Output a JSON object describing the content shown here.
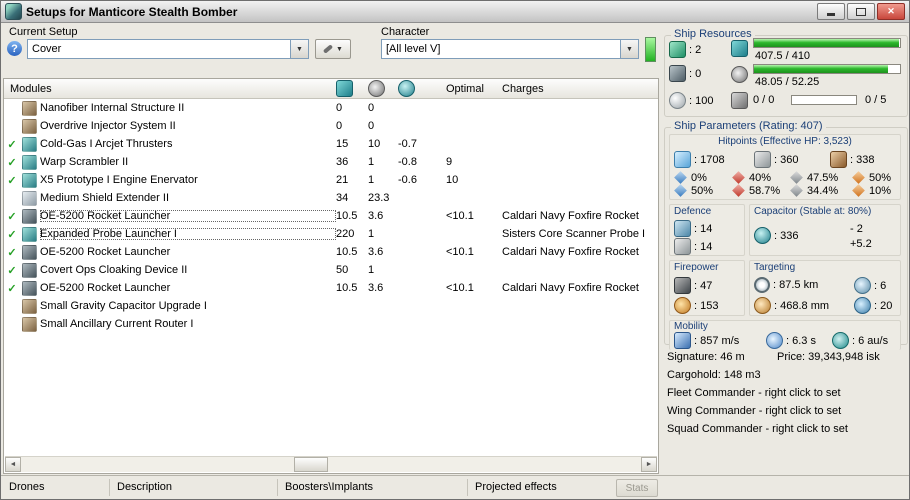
{
  "window": {
    "title": "Setups for Manticore Stealth Bomber"
  },
  "icons": {
    "help": "?",
    "arrow_down": "▼",
    "close": "✕",
    "scroll_left": "◄",
    "scroll_right": "►"
  },
  "toolbar": {
    "current_setup_label": "Current Setup",
    "current_setup_value": "Cover",
    "character_label": "Character",
    "character_value": "[All level V]"
  },
  "modules": {
    "header": {
      "title": "Modules",
      "optimal": "Optimal",
      "charges": "Charges"
    },
    "rows": [
      {
        "check": "",
        "name": "Nanofiber Internal Structure II",
        "cpu": "0",
        "pg": "0",
        "cap": "",
        "optimal": "",
        "charges": ""
      },
      {
        "check": "",
        "name": "Overdrive Injector System II",
        "cpu": "0",
        "pg": "0",
        "cap": "",
        "optimal": "",
        "charges": ""
      },
      {
        "check": "✓",
        "name": "Cold-Gas I Arcjet Thrusters",
        "cpu": "15",
        "pg": "10",
        "cap": "-0.7",
        "optimal": "",
        "charges": ""
      },
      {
        "check": "✓",
        "name": "Warp Scrambler II",
        "cpu": "36",
        "pg": "1",
        "cap": "-0.8",
        "optimal": "9",
        "charges": ""
      },
      {
        "check": "✓",
        "name": "X5 Prototype I Engine Enervator",
        "cpu": "21",
        "pg": "1",
        "cap": "-0.6",
        "optimal": "10",
        "charges": ""
      },
      {
        "check": "",
        "name": "Medium Shield Extender II",
        "cpu": "34",
        "pg": "23.3",
        "cap": "",
        "optimal": "",
        "charges": ""
      },
      {
        "check": "✓",
        "name": "OE-5200 Rocket Launcher",
        "cpu": "10.5",
        "pg": "3.6",
        "cap": "",
        "optimal": "<10.1",
        "charges": "Caldari Navy Foxfire Rocket"
      },
      {
        "check": "✓",
        "name": "Expanded Probe Launcher I",
        "cpu": "220",
        "pg": "1",
        "cap": "",
        "optimal": "",
        "charges": "Sisters Core Scanner Probe I"
      },
      {
        "check": "✓",
        "name": "OE-5200 Rocket Launcher",
        "cpu": "10.5",
        "pg": "3.6",
        "cap": "",
        "optimal": "<10.1",
        "charges": "Caldari Navy Foxfire Rocket"
      },
      {
        "check": "✓",
        "name": "Covert Ops Cloaking Device II",
        "cpu": "50",
        "pg": "1",
        "cap": "",
        "optimal": "",
        "charges": ""
      },
      {
        "check": "✓",
        "name": "OE-5200 Rocket Launcher",
        "cpu": "10.5",
        "pg": "3.6",
        "cap": "",
        "optimal": "<10.1",
        "charges": "Caldari Navy Foxfire Rocket"
      },
      {
        "check": "",
        "name": "Small Gravity Capacitor Upgrade I",
        "cpu": "",
        "pg": "",
        "cap": "",
        "optimal": "",
        "charges": ""
      },
      {
        "check": "",
        "name": "Small Ancillary Current Router I",
        "cpu": "",
        "pg": "",
        "cap": "",
        "optimal": "",
        "charges": ""
      }
    ]
  },
  "bottom_bar": {
    "drones": "Drones",
    "description": "Description",
    "boosters_implants": "Boosters\\Implants",
    "projected_effects": "Projected effects",
    "stats": "Stats"
  },
  "resources": {
    "title": "Ship Resources",
    "turret_hardpoints": ": 2",
    "launcher_hardpoints": ": 0",
    "calibration": ": 100",
    "cpu_text": "407.5 / 410",
    "powergrid_text": "48.05 / 52.25",
    "dronebay_text": "0 / 0",
    "drones_text": "0 / 5"
  },
  "parameters": {
    "title": "Ship Parameters (Rating: 407)",
    "hitpoints": {
      "title": "Hitpoints (Effective HP: 3,523)",
      "shield": ": 1708",
      "armor": ": 360",
      "structure": ": 338",
      "resists": {
        "shield": [
          "0%",
          "40%",
          "47.5%",
          "50%"
        ],
        "armor": [
          "50%",
          "58.7%",
          "34.4%",
          "10%"
        ]
      }
    },
    "defence": {
      "title": "Defence",
      "value1": ": 14",
      "value2": ": 14"
    },
    "capacitor": {
      "title": "Capacitor (Stable at: 80%)",
      "amount": ": 336",
      "peak": "- 2",
      "recharge": "+5.2"
    },
    "firepower": {
      "title": "Firepower",
      "volley": ": 47",
      "dps": ": 153"
    },
    "targeting": {
      "title": "Targeting",
      "range": ": 87.5 km",
      "max_targets": ": 6",
      "scan_resolution": ": 468.8 mm",
      "sensor_strength": ": 20"
    },
    "mobility": {
      "title": "Mobility",
      "speed": ": 857 m/s",
      "align_time": ": 6.3 s",
      "warp_speed": ": 6 au/s"
    },
    "info": {
      "signature": "Signature: 46 m",
      "price": "Price: 39,343,948 isk",
      "cargohold": "Cargohold: 148 m3",
      "fleet_commander": "Fleet Commander - right click to set",
      "wing_commander": "Wing Commander - right click to set",
      "squad_commander": "Squad Commander - right click to set"
    }
  }
}
